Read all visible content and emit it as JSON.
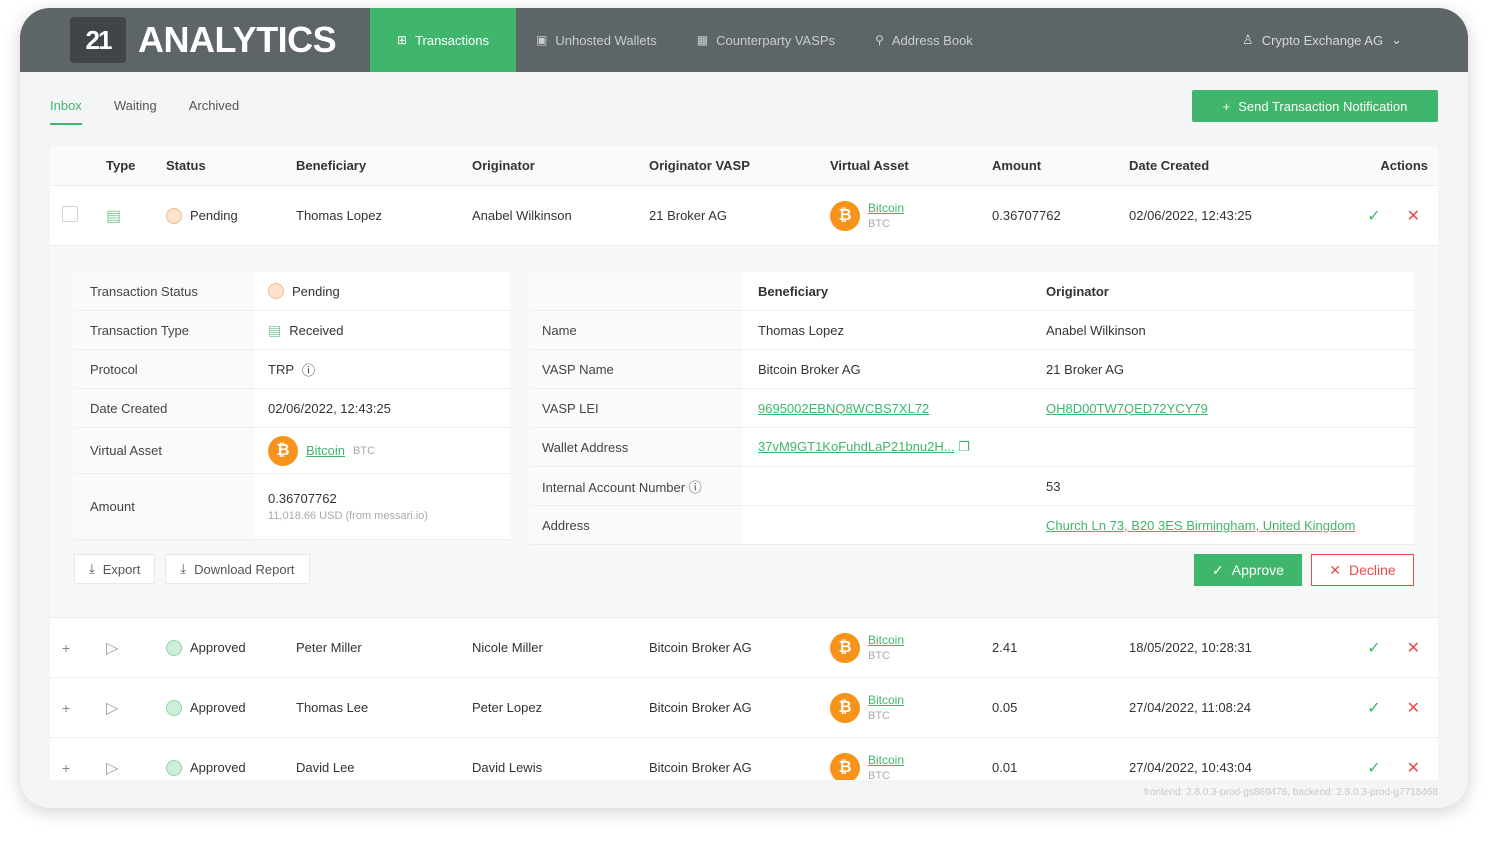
{
  "brand": {
    "logo": "21",
    "name": "ANALYTICS"
  },
  "nav": [
    {
      "label": "Transactions",
      "icon": "⊞",
      "active": true
    },
    {
      "label": "Unhosted Wallets",
      "icon": "▣",
      "active": false
    },
    {
      "label": "Counterparty VASPs",
      "icon": "▦",
      "active": false
    },
    {
      "label": "Address Book",
      "icon": "⚲",
      "active": false
    }
  ],
  "account": {
    "icon": "♙",
    "label": "Crypto Exchange AG",
    "chevron": "⌄"
  },
  "subtabs": [
    "Inbox",
    "Waiting",
    "Archived"
  ],
  "send_button": {
    "icon": "+",
    "label": "Send Transaction Notification"
  },
  "columns": [
    "Type",
    "Status",
    "Beneficiary",
    "Originator",
    "Originator VASP",
    "Virtual Asset",
    "Amount",
    "Date Created",
    "Actions"
  ],
  "rows": [
    {
      "type_icon": "▤",
      "status": "Pending",
      "beneficiary": "Thomas Lopez",
      "originator": "Anabel Wilkinson",
      "vasp": "21 Broker AG",
      "asset": "Bitcoin",
      "symbol": "BTC",
      "amount": "0.36707762",
      "date": "02/06/2022, 12:43:25"
    },
    {
      "type_icon": "▷",
      "status": "Approved",
      "beneficiary": "Peter Miller",
      "originator": "Nicole Miller",
      "vasp": "Bitcoin Broker AG",
      "asset": "Bitcoin",
      "symbol": "BTC",
      "amount": "2.41",
      "date": "18/05/2022, 10:28:31"
    },
    {
      "type_icon": "▷",
      "status": "Approved",
      "beneficiary": "Thomas Lee",
      "originator": "Peter Lopez",
      "vasp": "Bitcoin Broker AG",
      "asset": "Bitcoin",
      "symbol": "BTC",
      "amount": "0.05",
      "date": "27/04/2022, 11:08:24"
    },
    {
      "type_icon": "▷",
      "status": "Approved",
      "beneficiary": "David Lee",
      "originator": "David Lewis",
      "vasp": "Bitcoin Broker AG",
      "asset": "Bitcoin",
      "symbol": "BTC",
      "amount": "0.01",
      "date": "27/04/2022, 10:43:04"
    }
  ],
  "details": {
    "labels": {
      "status": "Transaction Status",
      "type": "Transaction Type",
      "protocol": "Protocol",
      "date": "Date Created",
      "asset": "Virtual Asset",
      "amount": "Amount"
    },
    "status": "Pending",
    "type": "Received",
    "protocol": "TRP",
    "protocol_info": "ⓘ",
    "date": "02/06/2022, 12:43:25",
    "asset": "Bitcoin",
    "symbol": "BTC",
    "amount": "0.36707762",
    "amount_usd": "11,018.66 USD (from messari.io)"
  },
  "parties": {
    "header": {
      "beneficiary": "Beneficiary",
      "originator": "Originator"
    },
    "rows": [
      {
        "label": "Name",
        "beneficiary": "Thomas Lopez",
        "originator": "Anabel Wilkinson"
      },
      {
        "label": "VASP Name",
        "beneficiary": "Bitcoin Broker AG",
        "originator": "21 Broker AG"
      },
      {
        "label": "VASP LEI",
        "beneficiary": "9695002EBNQ8WCBS7XL72",
        "originator": "OH8D00TW7QED72YCY79"
      },
      {
        "label": "Wallet Address",
        "beneficiary": "37vM9GT1KoFuhdLaP21bnu2H...",
        "originator": ""
      },
      {
        "label": "Internal Account Number ⓘ",
        "beneficiary": "",
        "originator": "53"
      },
      {
        "label": "Address",
        "beneficiary": "",
        "originator": "Church Ln 73, B20 3ES Birmingham, United Kingdom"
      }
    ]
  },
  "actions": {
    "export": "Export",
    "download": "Download Report",
    "approve": "Approve",
    "decline": "Decline"
  },
  "version": "frontend: 2.8.0.3-prod-gs869476, backend: 2.8.0.3-prod-g7718468"
}
